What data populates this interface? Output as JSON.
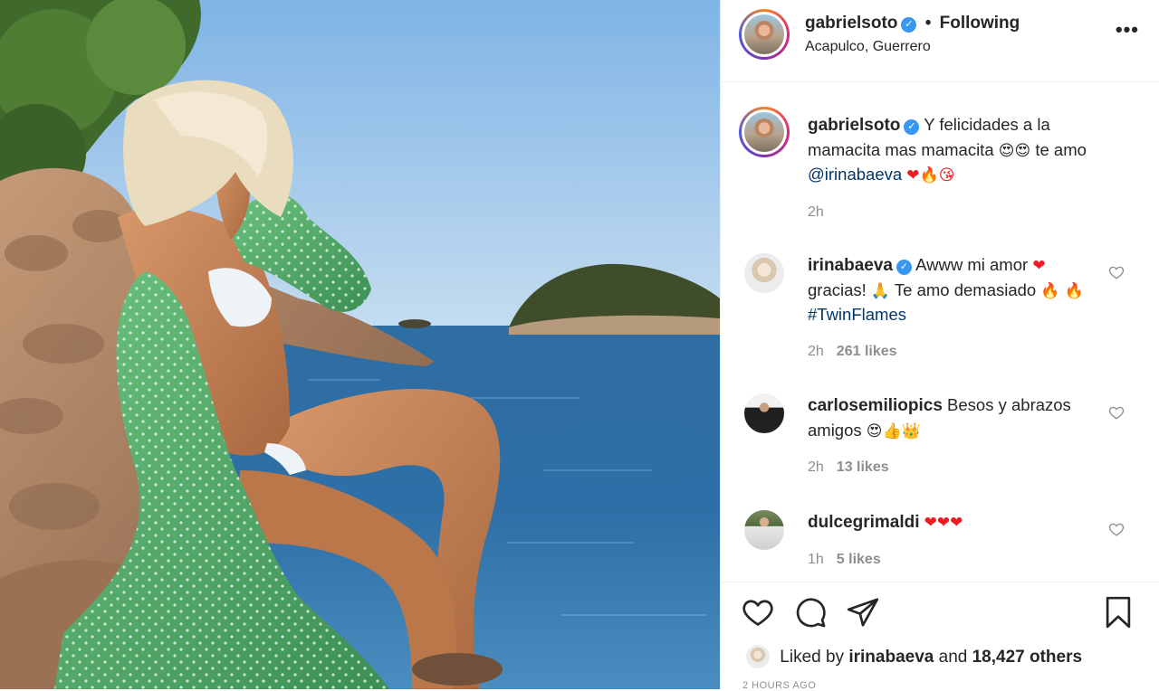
{
  "post": {
    "username": "gabrielsoto",
    "verified_mark": "✓",
    "separator": "•",
    "follow_label": "Following",
    "location": "Acapulco, Guerrero",
    "more_label": "•••",
    "caption_text": "Y felicidades a la mamacita mas mamacita",
    "caption_emoji_1": "😍😍",
    "caption_text_2": "te amo",
    "caption_mention": "@irinabaeva",
    "caption_emoji_2": "❤🔥😘",
    "caption_time": "2h"
  },
  "comments": [
    {
      "username": "irinabaeva",
      "text_1": "Awww mi amor",
      "emoji_1": "❤",
      "text_2": "gracias!",
      "emoji_2": "🙏",
      "text_3": "Te amo demasiado",
      "emoji_3": "🔥",
      "emoji_4": "🔥",
      "hashtag": "#TwinFlames",
      "time": "2h",
      "likes": "261 likes"
    },
    {
      "username": "carlosemiliopics",
      "text_1": "Besos y abrazos amigos",
      "emoji_1": "😍👍👑",
      "time": "2h",
      "likes": "13 likes"
    },
    {
      "username": "dulcegrimaldi",
      "emoji_1": "❤❤❤",
      "time": "1h",
      "likes": "5 likes"
    }
  ],
  "likes_bar": {
    "prefix": "Liked by",
    "user": "irinabaeva",
    "middle": "and",
    "others": "18,427 others",
    "timestamp": "2 HOURS AGO"
  },
  "icons": {
    "like": "heart-icon",
    "comment": "comment-icon",
    "share": "share-icon",
    "save": "bookmark-icon",
    "more": "more-icon"
  },
  "colors": {
    "verified": "#3897f0",
    "mention": "#00376b",
    "muted": "#8e8e8e",
    "text": "#262626"
  }
}
